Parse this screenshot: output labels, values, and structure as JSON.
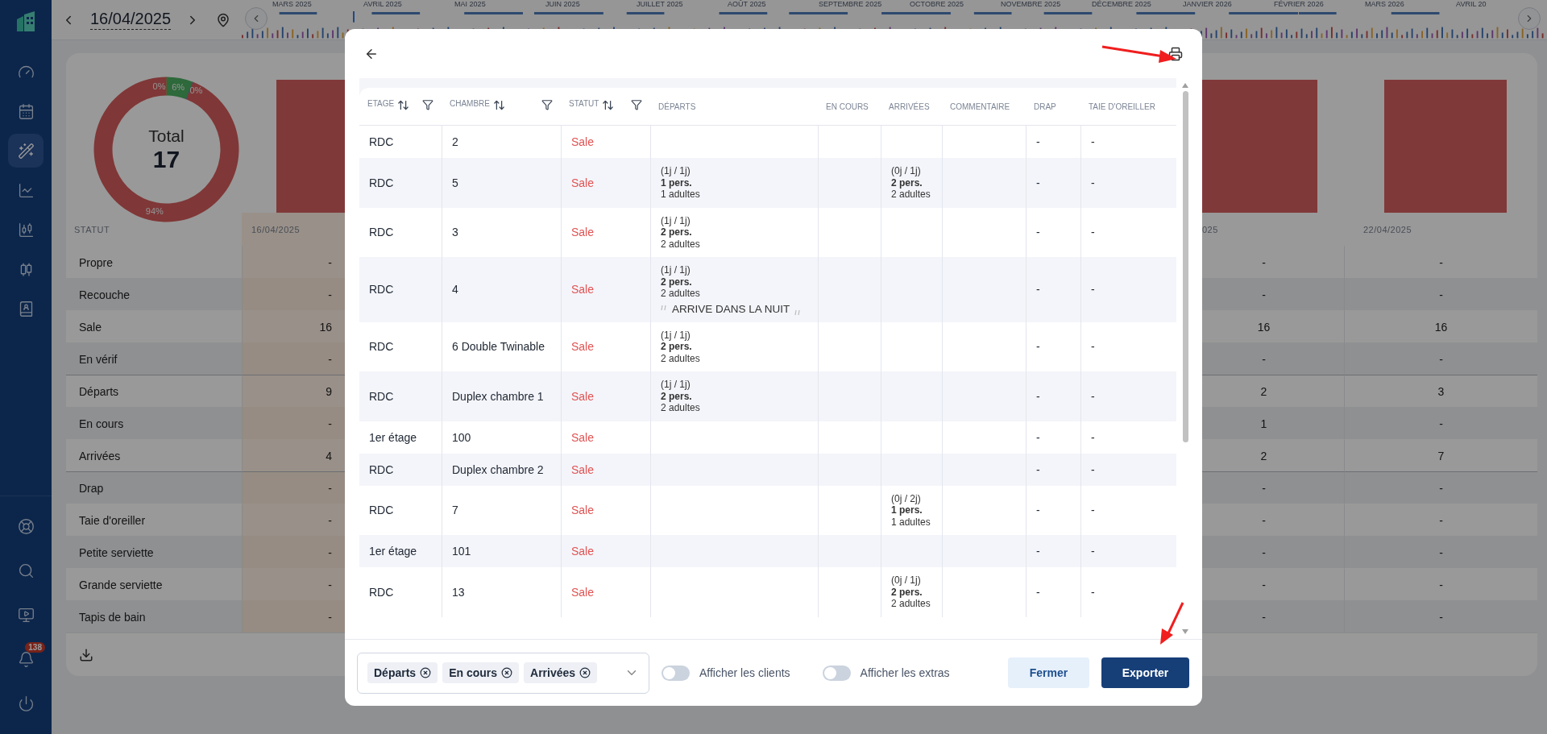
{
  "sidebar": {
    "items": [
      {
        "kind": "gauge",
        "selected": false
      },
      {
        "kind": "calendar",
        "selected": false
      },
      {
        "kind": "wand",
        "selected": true
      },
      {
        "kind": "line-chart",
        "selected": false
      },
      {
        "kind": "candles-axis",
        "selected": false
      },
      {
        "kind": "candles",
        "selected": false
      },
      {
        "kind": "contacts",
        "selected": false
      }
    ],
    "bottom_items": [
      {
        "kind": "lifebuoy"
      },
      {
        "kind": "search"
      },
      {
        "kind": "monitor"
      },
      {
        "kind": "bell",
        "badge": "138"
      },
      {
        "kind": "power"
      }
    ]
  },
  "date_nav": {
    "date": "16/04/2025"
  },
  "timeline": {
    "months": [
      "MARS 2025",
      "AVRIL 2025",
      "MAI 2025",
      "JUIN 2025",
      "JUILLET 2025",
      "AOÛT 2025",
      "SEPTEMBRE 2025",
      "OCTOBRE 2025",
      "NOVEMBRE 2025",
      "DÉCEMBRE 2025",
      "JANVIER 2026",
      "FÉVRIER 2026",
      "MARS 2026",
      "AVRIL 20"
    ]
  },
  "summary": {
    "total_label": "Total",
    "total": "17",
    "chart_data": {
      "type": "donut",
      "values": [
        0,
        6,
        0,
        94
      ],
      "colors": [
        "#e0a84a",
        "#4caf62",
        "#4a7fd0",
        "#d55d5d"
      ],
      "value_labels": [
        "0%",
        "6%",
        "0%",
        "94%"
      ]
    },
    "table": {
      "header": "STATUT",
      "columns": [
        {
          "label": "16/04/2025",
          "selected": true
        },
        {
          "label": "025",
          "selected": false
        },
        {
          "label": "22/04/2025",
          "selected": false
        }
      ],
      "rows": [
        {
          "label": "Propre",
          "divider_above": false,
          "values": [
            "-",
            "-",
            "-"
          ]
        },
        {
          "label": "Recouche",
          "divider_above": false,
          "values": [
            "-",
            "-",
            "-"
          ]
        },
        {
          "label": "Sale",
          "divider_above": false,
          "values": [
            "16",
            "16",
            "16"
          ]
        },
        {
          "label": "En vérif",
          "divider_above": false,
          "values": [
            "-",
            "-",
            "-"
          ]
        },
        {
          "label": "Départs",
          "divider_above": true,
          "values": [
            "9",
            "2",
            "3"
          ]
        },
        {
          "label": "En cours",
          "divider_above": false,
          "values": [
            "-",
            "1",
            "-"
          ]
        },
        {
          "label": "Arrivées",
          "divider_above": false,
          "values": [
            "4",
            "2",
            "7"
          ]
        },
        {
          "label": "Drap",
          "divider_above": true,
          "values": [
            "-",
            "-",
            "-"
          ]
        },
        {
          "label": "Taie d'oreiller",
          "divider_above": false,
          "values": [
            "-",
            "-",
            "-"
          ]
        },
        {
          "label": "Petite serviette",
          "divider_above": false,
          "values": [
            "-",
            "-",
            "-"
          ]
        },
        {
          "label": "Grande serviette",
          "divider_above": false,
          "values": [
            "-",
            "-",
            "-"
          ]
        },
        {
          "label": "Tapis de bain",
          "divider_above": false,
          "values": [
            "-",
            "-",
            "-"
          ]
        }
      ]
    }
  },
  "modal": {
    "columns": [
      {
        "label": "ETAGE",
        "sortable": true,
        "filterable": true
      },
      {
        "label": "CHAMBRE",
        "sortable": true,
        "filterable": true
      },
      {
        "label": "STATUT",
        "sortable": true,
        "filterable": true
      },
      {
        "label": "DÉPARTS",
        "sortable": false,
        "filterable": false
      },
      {
        "label": "EN COURS",
        "sortable": false,
        "filterable": false
      },
      {
        "label": "ARRIVÉES",
        "sortable": false,
        "filterable": false
      },
      {
        "label": "COMMENTAIRE",
        "sortable": false,
        "filterable": false
      },
      {
        "label": "DRAP",
        "sortable": false,
        "filterable": false
      },
      {
        "label": "TAIE D'OREILLER",
        "sortable": false,
        "filterable": false
      }
    ],
    "rows": [
      {
        "etage": "RDC",
        "chambre": "2",
        "statut": "Sale",
        "drap": "-",
        "taie": "-"
      },
      {
        "etage": "RDC",
        "chambre": "5",
        "statut": "Sale",
        "departs": {
          "stay": "(1j / 1j)",
          "people": "1 pers.",
          "adults": "1 adultes"
        },
        "arrivees": {
          "stay": "(0j / 1j)",
          "people": "2 pers.",
          "adults": "2 adultes"
        },
        "drap": "-",
        "taie": "-"
      },
      {
        "etage": "RDC",
        "chambre": "3",
        "statut": "Sale",
        "departs": {
          "stay": "(1j / 1j)",
          "people": "2 pers.",
          "adults": "2 adultes"
        },
        "drap": "-",
        "taie": "-"
      },
      {
        "etage": "RDC",
        "chambre": "4",
        "statut": "Sale",
        "departs": {
          "stay": "(1j / 1j)",
          "people": "2 pers.",
          "adults": "2 adultes",
          "note": "ARRIVE DANS LA NUIT"
        },
        "drap": "-",
        "taie": "-"
      },
      {
        "etage": "RDC",
        "chambre": "6 Double Twinable",
        "statut": "Sale",
        "departs": {
          "stay": "(1j / 1j)",
          "people": "2 pers.",
          "adults": "2 adultes"
        },
        "drap": "-",
        "taie": "-"
      },
      {
        "etage": "RDC",
        "chambre": "Duplex chambre 1",
        "statut": "Sale",
        "departs": {
          "stay": "(1j / 1j)",
          "people": "2 pers.",
          "adults": "2 adultes"
        },
        "drap": "-",
        "taie": "-"
      },
      {
        "etage": "1er étage",
        "chambre": "100",
        "statut": "Sale",
        "drap": "-",
        "taie": "-"
      },
      {
        "etage": "RDC",
        "chambre": "Duplex chambre 2",
        "statut": "Sale",
        "drap": "-",
        "taie": "-"
      },
      {
        "etage": "RDC",
        "chambre": "7",
        "statut": "Sale",
        "arrivees": {
          "stay": "(0j / 2j)",
          "people": "1 pers.",
          "adults": "1 adultes"
        },
        "drap": "-",
        "taie": "-"
      },
      {
        "etage": "1er étage",
        "chambre": "101",
        "statut": "Sale",
        "drap": "-",
        "taie": "-"
      },
      {
        "etage": "RDC",
        "chambre": "13",
        "statut": "Sale",
        "arrivees": {
          "stay": "(0j / 1j)",
          "people": "2 pers.",
          "adults": "2 adultes"
        },
        "drap": "-",
        "taie": "-"
      }
    ],
    "chips": [
      "Départs",
      "En cours",
      "Arrivées"
    ],
    "toggles": [
      {
        "label": "Afficher les clients",
        "on": false
      },
      {
        "label": "Afficher les extras",
        "on": false
      }
    ],
    "buttons": [
      {
        "label": "Fermer",
        "kind": "secondary"
      },
      {
        "label": "Exporter",
        "kind": "primary"
      }
    ]
  }
}
